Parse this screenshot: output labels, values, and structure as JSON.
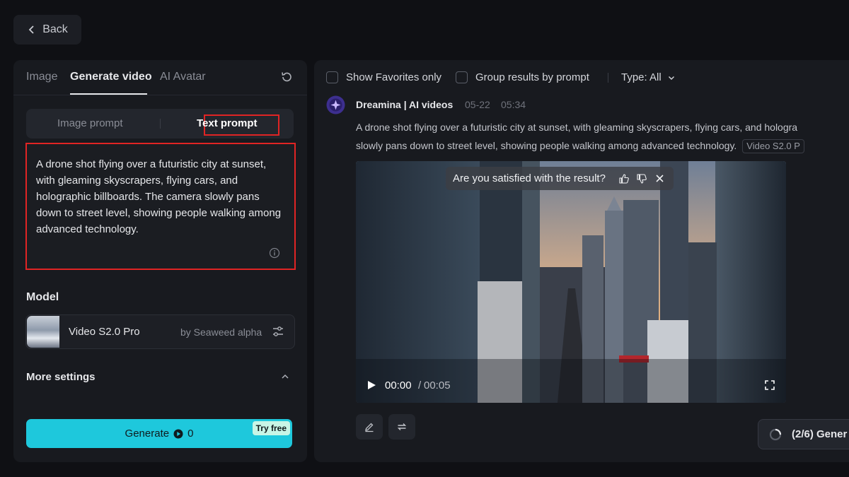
{
  "back": {
    "label": "Back"
  },
  "left": {
    "tabs": [
      "Image",
      "Generate video",
      "AI Avatar"
    ],
    "active_tab": "Generate video",
    "prompt_modes": [
      "Image prompt",
      "Text prompt"
    ],
    "active_mode": "Text prompt",
    "prompt_text": "A drone shot flying over a futuristic city at sunset, with gleaming skyscrapers, flying cars, and holographic billboards. The camera slowly pans down to street level, showing people walking among advanced technology.",
    "model_label": "Model",
    "model": {
      "name": "Video S2.0 Pro",
      "by": "by Seaweed alpha"
    },
    "more_settings": "More settings",
    "generate": {
      "label": "Generate",
      "credits": "0",
      "badge": "Try free"
    }
  },
  "right": {
    "filters": {
      "favorites": "Show Favorites only",
      "group": "Group results by prompt",
      "type": "Type: All"
    },
    "result": {
      "author": "Dreamina | AI videos",
      "date": "05-22",
      "time": "05:34",
      "desc_line1": "A drone shot flying over a futuristic city at sunset, with gleaming skyscrapers, flying cars, and hologra",
      "desc_line2": "slowly pans down to street level, showing people walking among advanced technology.",
      "model_tag": "Video S2.0 P",
      "satisfaction": "Are you satisfied with the result?",
      "current_time": "00:00",
      "time_sep": "/",
      "total_time": "00:05"
    },
    "progress": "(2/6) Gener"
  },
  "colors": {
    "accent": "#1ec8dc",
    "highlight_border": "#e02424",
    "panel": "#181a1f",
    "background": "#0f1014"
  },
  "icons": [
    "chevron-left-icon",
    "refresh-icon",
    "info-icon",
    "sliders-icon",
    "chevron-up-icon",
    "credit-icon",
    "dreamina-logo-icon",
    "thumb-up-icon",
    "thumb-down-icon",
    "close-icon",
    "play-icon",
    "fullscreen-icon",
    "edit-icon",
    "regenerate-icon",
    "spinner-icon",
    "chevron-down-icon"
  ]
}
